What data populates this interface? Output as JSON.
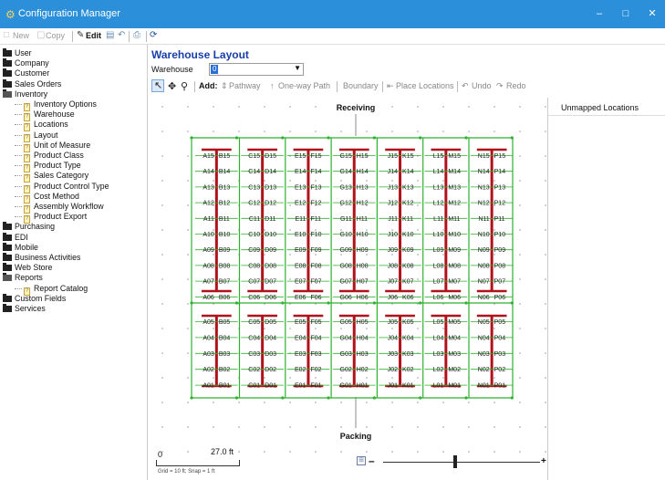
{
  "window": {
    "title": "Configuration Manager",
    "minimize": "–",
    "maximize": "□",
    "close": "✕"
  },
  "toolbar": {
    "new": "New",
    "copy": "Copy",
    "edit": "Edit"
  },
  "tree": [
    {
      "label": "User",
      "level": 0,
      "type": "folder"
    },
    {
      "label": "Company",
      "level": 0,
      "type": "folder"
    },
    {
      "label": "Customer",
      "level": 0,
      "type": "folder"
    },
    {
      "label": "Sales Orders",
      "level": 0,
      "type": "folder"
    },
    {
      "label": "Inventory",
      "level": 0,
      "type": "folder-open"
    },
    {
      "label": "Inventory Options",
      "level": 1,
      "type": "doc"
    },
    {
      "label": "Warehouse",
      "level": 1,
      "type": "doc"
    },
    {
      "label": "Locations",
      "level": 1,
      "type": "doc"
    },
    {
      "label": "Layout",
      "level": 1,
      "type": "doc"
    },
    {
      "label": "Unit of Measure",
      "level": 1,
      "type": "doc"
    },
    {
      "label": "Product Class",
      "level": 1,
      "type": "doc"
    },
    {
      "label": "Product Type",
      "level": 1,
      "type": "doc"
    },
    {
      "label": "Sales Category",
      "level": 1,
      "type": "doc"
    },
    {
      "label": "Product Control Type",
      "level": 1,
      "type": "doc"
    },
    {
      "label": "Cost Method",
      "level": 1,
      "type": "doc"
    },
    {
      "label": "Assembly Workflow",
      "level": 1,
      "type": "doc"
    },
    {
      "label": "Product Export",
      "level": 1,
      "type": "doc"
    },
    {
      "label": "Purchasing",
      "level": 0,
      "type": "folder"
    },
    {
      "label": "EDI",
      "level": 0,
      "type": "folder"
    },
    {
      "label": "Mobile",
      "level": 0,
      "type": "folder"
    },
    {
      "label": "Business Activities",
      "level": 0,
      "type": "folder"
    },
    {
      "label": "Web Store",
      "level": 0,
      "type": "folder"
    },
    {
      "label": "Reports",
      "level": 0,
      "type": "folder-open"
    },
    {
      "label": "Report Catalog",
      "level": 1,
      "type": "doc"
    },
    {
      "label": "Custom Fields",
      "level": 0,
      "type": "folder"
    },
    {
      "label": "Services",
      "level": 0,
      "type": "folder"
    }
  ],
  "layout": {
    "title": "Warehouse Layout",
    "warehouse_label": "Warehouse",
    "warehouse_value": "0",
    "add_label": "Add:",
    "pathway": "Pathway",
    "one_way_path": "One-way Path",
    "boundary": "Boundary",
    "place_locations": "Place Locations",
    "undo": "Undo",
    "redo": "Redo",
    "receiving": "Receiving",
    "packing": "Packing",
    "unmapped": "Unmapped Locations",
    "scale_start": "0",
    "scale_end": "27.0 ft",
    "grid_note": "Grid = 10 ft; Snap = 1 ft",
    "zoom_minus": "–",
    "zoom_plus": "+",
    "zoom_level": 0.45
  },
  "rack_groups": [
    {
      "letters": [
        "A",
        "B"
      ],
      "top": [
        15,
        14,
        13,
        12,
        11,
        10,
        9,
        8,
        7,
        6
      ],
      "bottom": [
        5,
        4,
        3,
        2,
        1
      ]
    },
    {
      "letters": [
        "C",
        "D"
      ],
      "top": [
        15,
        14,
        13,
        12,
        11,
        10,
        9,
        8,
        7,
        6
      ],
      "bottom": [
        5,
        4,
        3,
        2,
        1
      ]
    },
    {
      "letters": [
        "E",
        "F"
      ],
      "top": [
        15,
        14,
        13,
        12,
        11,
        10,
        9,
        8,
        7,
        6
      ],
      "bottom": [
        5,
        4,
        3,
        2,
        1
      ]
    },
    {
      "letters": [
        "G",
        "H"
      ],
      "top": [
        15,
        14,
        13,
        12,
        11,
        10,
        9,
        8,
        7,
        6
      ],
      "bottom": [
        5,
        4,
        3,
        2,
        1
      ]
    },
    {
      "letters": [
        "J",
        "K"
      ],
      "top": [
        15,
        14,
        13,
        12,
        11,
        10,
        9,
        8,
        7,
        6
      ],
      "bottom": [
        5,
        4,
        3,
        2,
        1
      ]
    },
    {
      "letters": [
        "L",
        "M"
      ],
      "top": [
        15,
        14,
        13,
        12,
        11,
        10,
        9,
        8,
        7,
        6
      ],
      "bottom": [
        5,
        4,
        3,
        2,
        1
      ]
    },
    {
      "letters": [
        "N",
        "P"
      ],
      "top": [
        15,
        14,
        13,
        12,
        11,
        10,
        9,
        8,
        7,
        6
      ],
      "bottom": [
        5,
        4,
        3,
        2,
        1
      ]
    }
  ],
  "colors": {
    "titlebar": "#2b90d9",
    "rack": "#b0121b",
    "path": "#2fb12f",
    "layout_title": "#1a3ea8"
  }
}
